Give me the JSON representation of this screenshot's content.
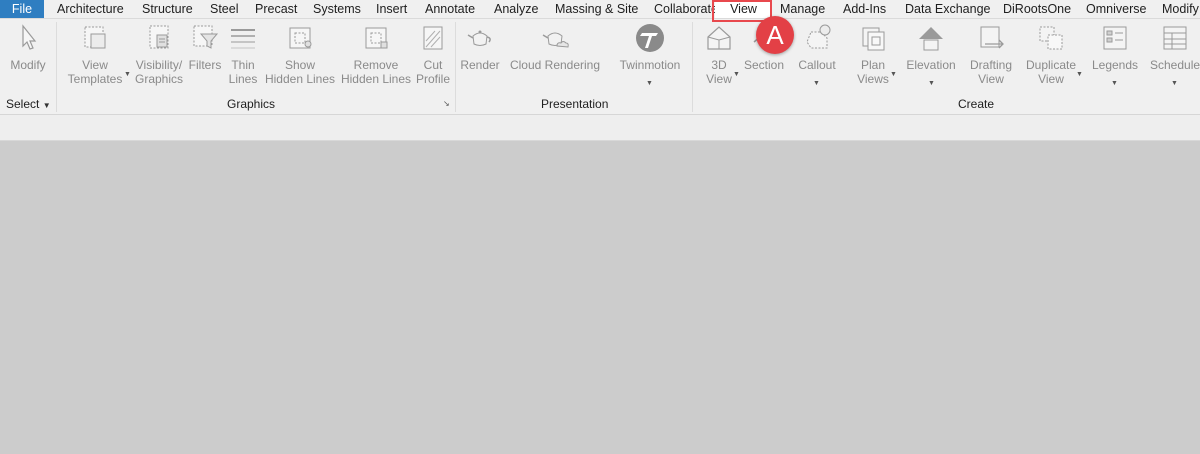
{
  "tabs": [
    "File",
    "Architecture",
    "Structure",
    "Steel",
    "Precast",
    "Systems",
    "Insert",
    "Annotate",
    "Analyze",
    "Massing & Site",
    "Collaborate",
    "View",
    "Manage",
    "Add-Ins",
    "Data Exchange",
    "DiRootsOne",
    "Omniverse",
    "Modify"
  ],
  "buttons": {
    "modify": "Modify",
    "view_templates": [
      "View",
      "Templates"
    ],
    "visibility_graphics": [
      "Visibility/",
      "Graphics"
    ],
    "filters": "Filters",
    "thin_lines": [
      "Thin",
      "Lines"
    ],
    "show_hidden": [
      "Show",
      "Hidden Lines"
    ],
    "remove_hidden": [
      "Remove",
      "Hidden Lines"
    ],
    "cut_profile": [
      "Cut",
      "Profile"
    ],
    "render": "Render",
    "cloud_rendering": "Cloud Rendering",
    "twinmotion": "Twinmotion",
    "view_3d": [
      "3D",
      "View"
    ],
    "section": "Section",
    "callout": "Callout",
    "plan_views": [
      "Plan",
      "Views"
    ],
    "elevation": "Elevation",
    "drafting_view": [
      "Drafting",
      "View"
    ],
    "duplicate_view": [
      "Duplicate",
      "View"
    ],
    "legends": "Legends",
    "schedules": "Schedule"
  },
  "panels": {
    "select": "Select",
    "graphics": "Graphics",
    "presentation": "Presentation",
    "create": "Create"
  },
  "annotation": {
    "label": "A",
    "color": "#e34046"
  },
  "colors": {
    "file_tab": "#2f7ec1",
    "ribbon": "#f0f0f0",
    "canvas": "#cccccc"
  }
}
